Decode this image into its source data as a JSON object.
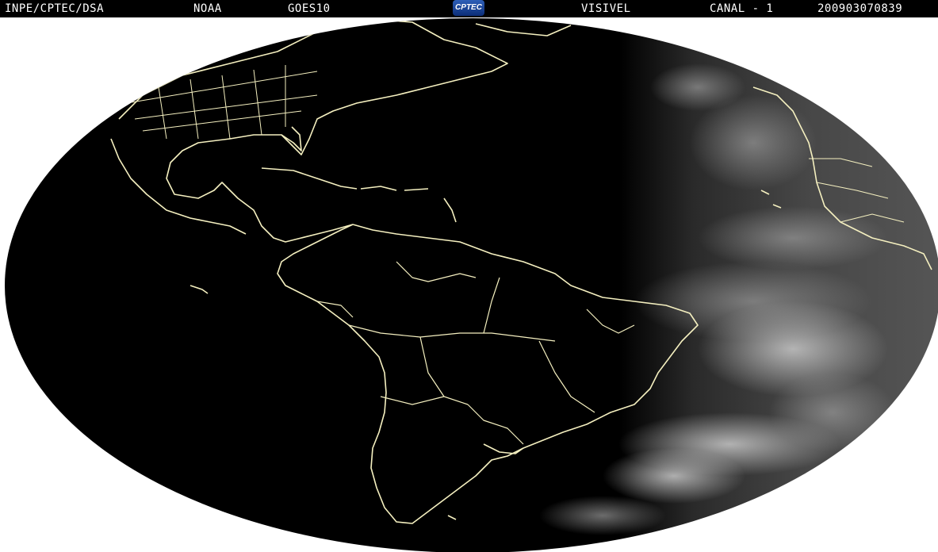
{
  "header": {
    "source": "INPE/CPTEC/DSA",
    "agency": "NOAA",
    "satellite": "GOES10",
    "logo_text": "CPTEC",
    "band": "VISIVEL",
    "channel": "CANAL - 1",
    "timestamp": "200903070839"
  },
  "map": {
    "projection": "full-disk-ellipse",
    "illumination": "night-west-day-east",
    "colors": {
      "background": "#ffffff",
      "night_side": "#000000",
      "day_side": "#4a4a4a",
      "coastline": "#f5f0c0"
    }
  }
}
